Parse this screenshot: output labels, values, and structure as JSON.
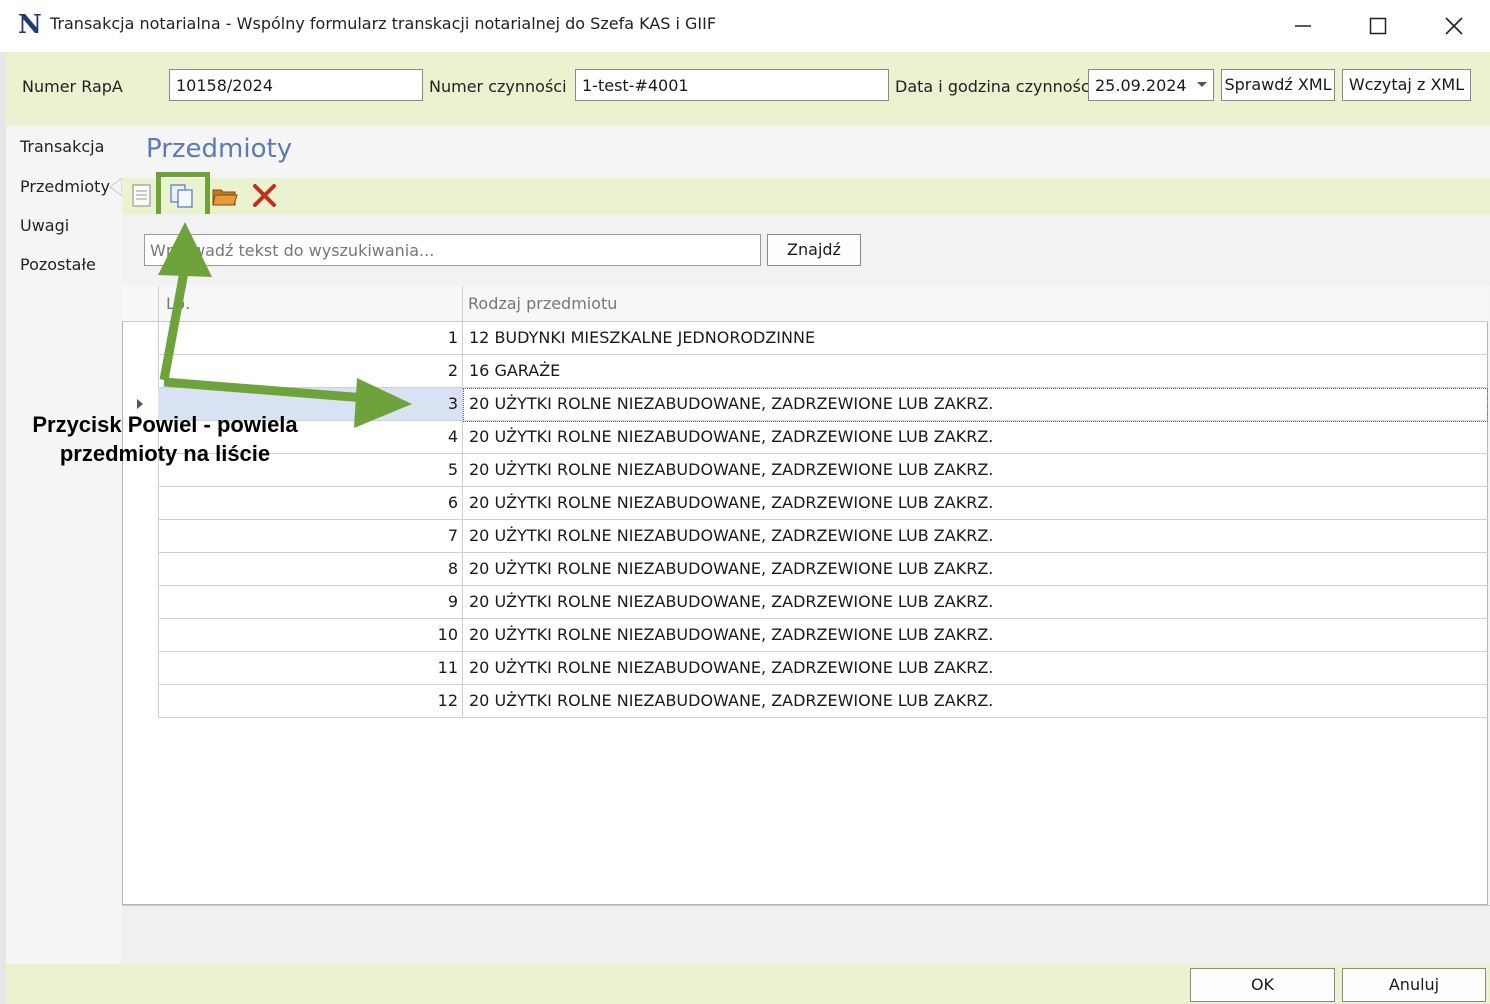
{
  "window": {
    "title": "Transakcja notarialna - Wspólny formularz transkacji notarialnej do Szefa KAS i GIIF",
    "app_icon_letter": "N",
    "minimize": "—",
    "maximize": "☐",
    "close": "✕"
  },
  "header": {
    "rapa_label": "Numer RapA",
    "rapa_value": "10158/2024",
    "czynnosc_label": "Numer czynności",
    "czynnosc_value": "1-test-#4001",
    "date_label": "Data i godzina czynności",
    "date_value": "25.09.2024",
    "check_xml": "Sprawdź XML",
    "load_xml": "Wczytaj z  XML"
  },
  "nav": {
    "items": [
      "Transakcja",
      "Przedmioty",
      "Uwagi",
      "Pozostałe"
    ],
    "active": "Przedmioty"
  },
  "section_title": "Przedmioty",
  "toolbar": {
    "icons": [
      "new-document-icon",
      "copy-documents-icon",
      "open-folder-icon",
      "delete-x-icon"
    ]
  },
  "search": {
    "placeholder": "Wprowadź tekst do wyszukiwania...",
    "button": "Znajdź"
  },
  "grid": {
    "columns": [
      "Lp.",
      "Rodzaj przedmiotu"
    ],
    "rows": [
      {
        "lp": "1",
        "kind": "12 BUDYNKI MIESZKALNE JEDNORODZINNE"
      },
      {
        "lp": "2",
        "kind": "16 GARAŻE"
      },
      {
        "lp": "3",
        "kind": "20 UŻYTKI ROLNE NIEZABUDOWANE, ZADRZEWIONE LUB ZAKRZ."
      },
      {
        "lp": "4",
        "kind": "20 UŻYTKI ROLNE NIEZABUDOWANE, ZADRZEWIONE LUB ZAKRZ."
      },
      {
        "lp": "5",
        "kind": "20 UŻYTKI ROLNE NIEZABUDOWANE, ZADRZEWIONE LUB ZAKRZ."
      },
      {
        "lp": "6",
        "kind": "20 UŻYTKI ROLNE NIEZABUDOWANE, ZADRZEWIONE LUB ZAKRZ."
      },
      {
        "lp": "7",
        "kind": "20 UŻYTKI ROLNE NIEZABUDOWANE, ZADRZEWIONE LUB ZAKRZ."
      },
      {
        "lp": "8",
        "kind": "20 UŻYTKI ROLNE NIEZABUDOWANE, ZADRZEWIONE LUB ZAKRZ."
      },
      {
        "lp": "9",
        "kind": "20 UŻYTKI ROLNE NIEZABUDOWANE, ZADRZEWIONE LUB ZAKRZ."
      },
      {
        "lp": "10",
        "kind": "20 UŻYTKI ROLNE NIEZABUDOWANE, ZADRZEWIONE LUB ZAKRZ."
      },
      {
        "lp": "11",
        "kind": "20 UŻYTKI ROLNE NIEZABUDOWANE, ZADRZEWIONE LUB ZAKRZ."
      },
      {
        "lp": "12",
        "kind": "20 UŻYTKI ROLNE NIEZABUDOWANE, ZADRZEWIONE LUB ZAKRZ."
      }
    ],
    "selected_row": "3"
  },
  "footer": {
    "ok": "OK",
    "cancel": "Anuluj"
  },
  "annotation": {
    "line1": "Przycisk Powiel - powiela",
    "line2": "przedmioty na liście",
    "color": "#6ea33c"
  }
}
